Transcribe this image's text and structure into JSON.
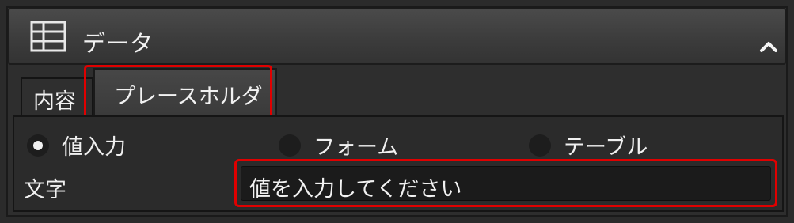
{
  "section": {
    "title": "データ",
    "icon": "table-grid-icon",
    "collapse_icon": "chevron-up-icon"
  },
  "tabs": [
    {
      "label": "内容",
      "selected": false
    },
    {
      "label": "プレースホルダー",
      "selected": true
    }
  ],
  "radio_options": [
    {
      "label": "値入力",
      "checked": true
    },
    {
      "label": "フォーム",
      "checked": false
    },
    {
      "label": "テーブル",
      "checked": false
    }
  ],
  "text_field": {
    "label": "文字",
    "value": "値を入力してください"
  },
  "colors": {
    "highlight": "#e00000",
    "panel_bg": "#2b2b2b",
    "text": "#f0f0f0"
  }
}
